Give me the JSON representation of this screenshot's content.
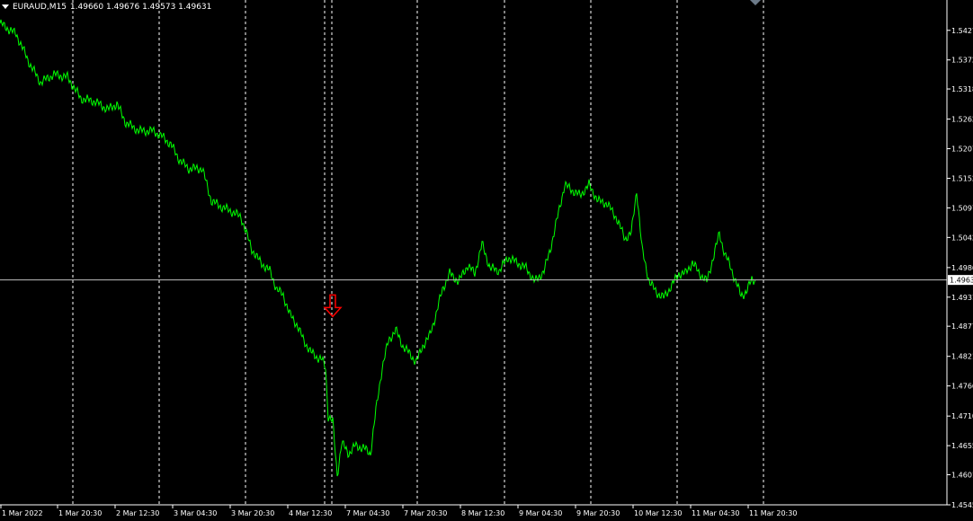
{
  "header": {
    "symbol_label": "EURAUD,M15",
    "ohlc_text": "1.49660 1.49676 1.49573 1.49631"
  },
  "current_price_label": "1.4963",
  "colors": {
    "line": "#00ff00",
    "grid": "#ffffff",
    "arrow": "#ff0000",
    "background": "#000000"
  },
  "chart_data": {
    "type": "line",
    "title": "",
    "xlabel": "",
    "ylabel": "",
    "ylim": [
      1.4545,
      1.546
    ],
    "x_tick_labels": [
      "1 Mar 2022",
      "1 Mar 20:30",
      "2 Mar 12:30",
      "3 Mar 04:30",
      "3 Mar 20:30",
      "4 Mar 12:30",
      "7 Mar 04:30",
      "7 Mar 20:30",
      "8 Mar 12:30",
      "9 Mar 04:30",
      "9 Mar 20:30",
      "10 Mar 12:30",
      "11 Mar 04:30",
      "11 Mar 20:30"
    ],
    "y_tick_labels": [
      "1.5427",
      "1.5372",
      "1.5318",
      "1.5262",
      "1.5207",
      "1.5152",
      "1.5097",
      "1.5042",
      "1.4986",
      "1.4931",
      "1.4877",
      "1.4821",
      "1.4766",
      "1.4710",
      "1.4655",
      "1.4601",
      "1.4545"
    ],
    "x_index_range": [
      0,
      848
    ],
    "series": [
      {
        "values": [
          [
            0,
            1.544
          ],
          [
            18,
            1.542
          ],
          [
            33,
            1.5365
          ],
          [
            45,
            1.533
          ],
          [
            60,
            1.5345
          ],
          [
            75,
            1.534
          ],
          [
            90,
            1.53
          ],
          [
            105,
            1.5295
          ],
          [
            120,
            1.528
          ],
          [
            130,
            1.529
          ],
          [
            140,
            1.5255
          ],
          [
            155,
            1.524
          ],
          [
            170,
            1.524
          ],
          [
            180,
            1.523
          ],
          [
            190,
            1.5215
          ],
          [
            200,
            1.5185
          ],
          [
            210,
            1.517
          ],
          [
            225,
            1.517
          ],
          [
            235,
            1.511
          ],
          [
            245,
            1.51
          ],
          [
            258,
            1.509
          ],
          [
            268,
            1.508
          ],
          [
            280,
            1.502
          ],
          [
            290,
            1.4995
          ],
          [
            300,
            1.498
          ],
          [
            308,
            1.4945
          ],
          [
            315,
            1.4935
          ],
          [
            322,
            1.49
          ],
          [
            330,
            1.488
          ],
          [
            338,
            1.485
          ],
          [
            345,
            1.483
          ],
          [
            352,
            1.482
          ],
          [
            358,
            1.4815
          ],
          [
            362,
            1.48
          ],
          [
            365,
            1.471
          ],
          [
            370,
            1.47
          ],
          [
            375,
            1.46
          ],
          [
            380,
            1.466
          ],
          [
            388,
            1.464
          ],
          [
            395,
            1.4655
          ],
          [
            405,
            1.465
          ],
          [
            412,
            1.464
          ],
          [
            418,
            1.472
          ],
          [
            425,
            1.48
          ],
          [
            432,
            1.485
          ],
          [
            440,
            1.487
          ],
          [
            448,
            1.484
          ],
          [
            456,
            1.4825
          ],
          [
            463,
            1.481
          ],
          [
            470,
            1.484
          ],
          [
            478,
            1.486
          ],
          [
            485,
            1.49
          ],
          [
            492,
            1.4945
          ],
          [
            500,
            1.4975
          ],
          [
            510,
            1.496
          ],
          [
            520,
            1.499
          ],
          [
            528,
            1.4975
          ],
          [
            536,
            1.503
          ],
          [
            545,
            1.4985
          ],
          [
            555,
            1.498
          ],
          [
            565,
            1.5005
          ],
          [
            575,
            1.4995
          ],
          [
            585,
            1.4985
          ],
          [
            595,
            1.496
          ],
          [
            605,
            1.498
          ],
          [
            612,
            1.502
          ],
          [
            620,
            1.508
          ],
          [
            628,
            1.514
          ],
          [
            636,
            1.513
          ],
          [
            645,
            1.512
          ],
          [
            655,
            1.514
          ],
          [
            665,
            1.511
          ],
          [
            675,
            1.5105
          ],
          [
            685,
            1.508
          ],
          [
            695,
            1.504
          ],
          [
            702,
            1.505
          ],
          [
            708,
            1.513
          ],
          [
            714,
            1.502
          ],
          [
            722,
            1.496
          ],
          [
            730,
            1.494
          ],
          [
            738,
            1.493
          ],
          [
            746,
            1.495
          ],
          [
            755,
            1.4975
          ],
          [
            762,
            1.4975
          ],
          [
            770,
            1.4995
          ],
          [
            778,
            1.4975
          ],
          [
            786,
            1.496
          ],
          [
            794,
            1.501
          ],
          [
            800,
            1.505
          ],
          [
            806,
            1.501
          ],
          [
            812,
            1.499
          ],
          [
            818,
            1.496
          ],
          [
            824,
            1.4935
          ],
          [
            830,
            1.494
          ],
          [
            836,
            1.4965
          ],
          [
            840,
            1.4963
          ]
        ]
      }
    ],
    "current_price": 1.4963,
    "annotations": [
      {
        "type": "down-arrow",
        "x": 370,
        "y": 1.4895
      }
    ],
    "grid": "vertical-dashed"
  }
}
